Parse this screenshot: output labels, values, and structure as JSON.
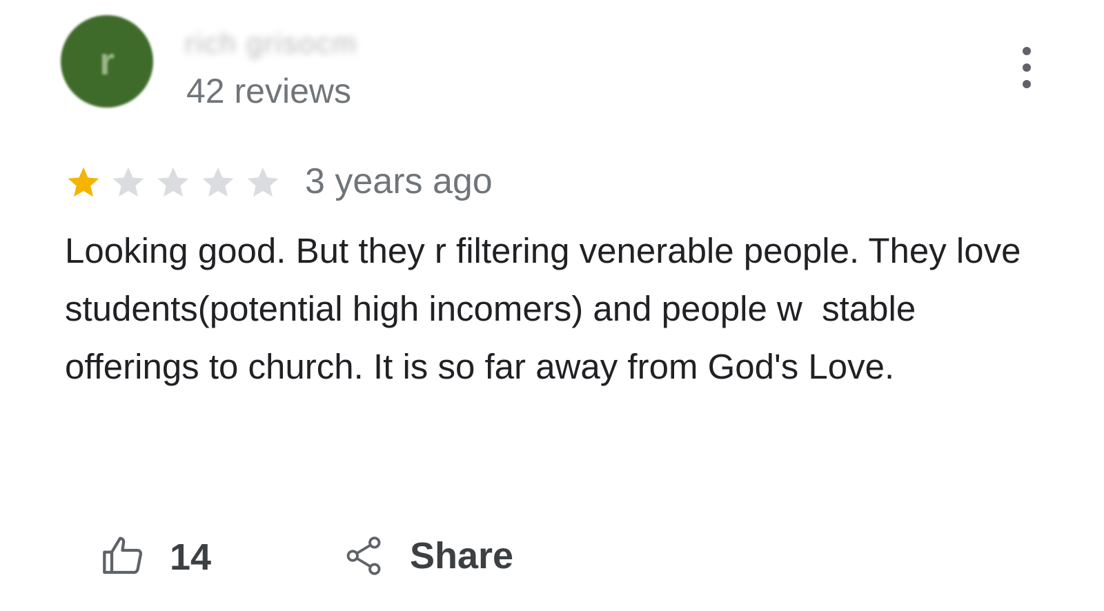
{
  "reviewer": {
    "avatar_letter": "r",
    "avatar_color": "#3f6b2a",
    "name": "rich grisocm",
    "review_count_text": "42 reviews"
  },
  "review": {
    "rating": 1,
    "max_rating": 5,
    "star_filled_color": "#f4b400",
    "star_empty_color": "#dadce0",
    "time_ago": "3 years ago",
    "text": "Looking good. But they r filtering venerable people. They love students(potential high incomers) and people w  stable offerings to church. It is so far away from God's Love."
  },
  "actions": {
    "like_icon": "thumbs-up-icon",
    "like_count": "14",
    "share_icon": "share-icon",
    "share_label": "Share",
    "more_icon": "more-vert-icon"
  }
}
